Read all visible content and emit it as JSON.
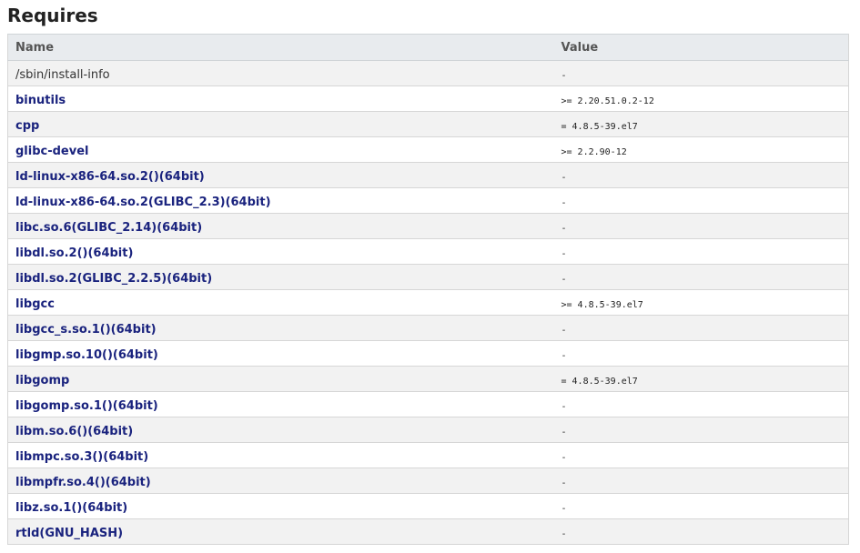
{
  "requires": {
    "title": "Requires",
    "columns": {
      "name": "Name",
      "value": "Value"
    },
    "rows": [
      {
        "name": "/sbin/install-info",
        "value": "-",
        "link": false
      },
      {
        "name": "binutils",
        "value": ">= 2.20.51.0.2-12",
        "link": true
      },
      {
        "name": "cpp",
        "value": "= 4.8.5-39.el7",
        "link": true
      },
      {
        "name": "glibc-devel",
        "value": ">= 2.2.90-12",
        "link": true
      },
      {
        "name": "ld-linux-x86-64.so.2()(64bit)",
        "value": "-",
        "link": true
      },
      {
        "name": "ld-linux-x86-64.so.2(GLIBC_2.3)(64bit)",
        "value": "-",
        "link": true
      },
      {
        "name": "libc.so.6(GLIBC_2.14)(64bit)",
        "value": "-",
        "link": true
      },
      {
        "name": "libdl.so.2()(64bit)",
        "value": "-",
        "link": true
      },
      {
        "name": "libdl.so.2(GLIBC_2.2.5)(64bit)",
        "value": "-",
        "link": true
      },
      {
        "name": "libgcc",
        "value": ">= 4.8.5-39.el7",
        "link": true
      },
      {
        "name": "libgcc_s.so.1()(64bit)",
        "value": "-",
        "link": true
      },
      {
        "name": "libgmp.so.10()(64bit)",
        "value": "-",
        "link": true
      },
      {
        "name": "libgomp",
        "value": "= 4.8.5-39.el7",
        "link": true
      },
      {
        "name": "libgomp.so.1()(64bit)",
        "value": "-",
        "link": true
      },
      {
        "name": "libm.so.6()(64bit)",
        "value": "-",
        "link": true
      },
      {
        "name": "libmpc.so.3()(64bit)",
        "value": "-",
        "link": true
      },
      {
        "name": "libmpfr.so.4()(64bit)",
        "value": "-",
        "link": true
      },
      {
        "name": "libz.so.1()(64bit)",
        "value": "-",
        "link": true
      },
      {
        "name": "rtld(GNU_HASH)",
        "value": "-",
        "link": true
      }
    ]
  },
  "colors": {
    "link": "#1a237e",
    "header_bg": "#e8ebee",
    "row_alt_bg": "#f2f2f2"
  }
}
